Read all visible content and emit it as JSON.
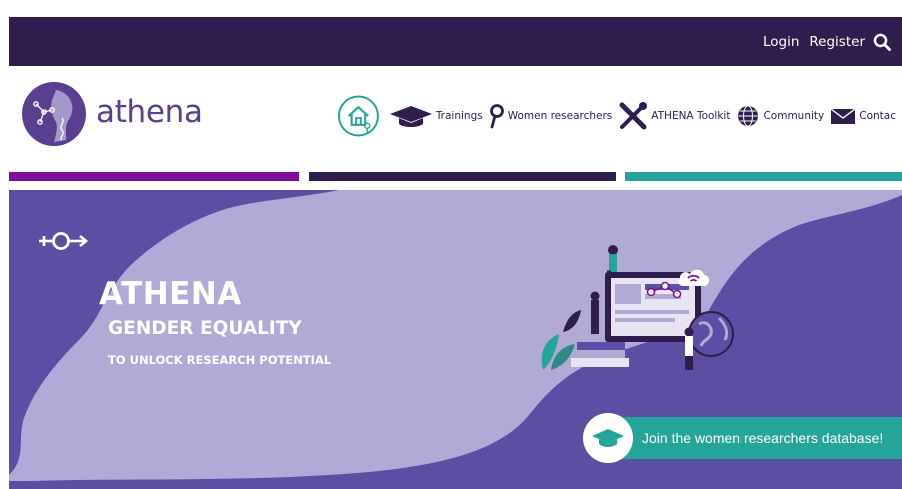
{
  "topbar": {
    "login_label": "Login",
    "register_label": "Register",
    "search_icon": "search-icon"
  },
  "header": {
    "brand_name": "athena",
    "logo_icon": "athena-logo"
  },
  "nav": {
    "home_icon": "home-icon",
    "items": [
      {
        "label": "Trainings",
        "icon": "graduation-cap-icon"
      },
      {
        "label": "Women researchers",
        "icon": "female-symbol-icon"
      },
      {
        "label": "ATHENA Toolkit",
        "icon": "tools-icon"
      },
      {
        "label": "Community",
        "icon": "globe-icon"
      },
      {
        "label": "Contac",
        "icon": "envelope-icon"
      }
    ]
  },
  "hero": {
    "title": "ATHENA",
    "subtitle": "GENDER EQUALITY",
    "tagline": "TO UNLOCK RESEARCH POTENTIAL",
    "symbol_icon": "gender-symbol-icon",
    "cta_label": "Join the women researchers database!",
    "cta_icon": "graduation-cap-icon"
  },
  "colors": {
    "dark_purple": "#2e1d4d",
    "brand_purple": "#5a3e8f",
    "magenta": "#7b0e9b",
    "teal": "#25a59a",
    "hero_dark": "#5c4fa3",
    "hero_light": "#b1a9d6"
  }
}
